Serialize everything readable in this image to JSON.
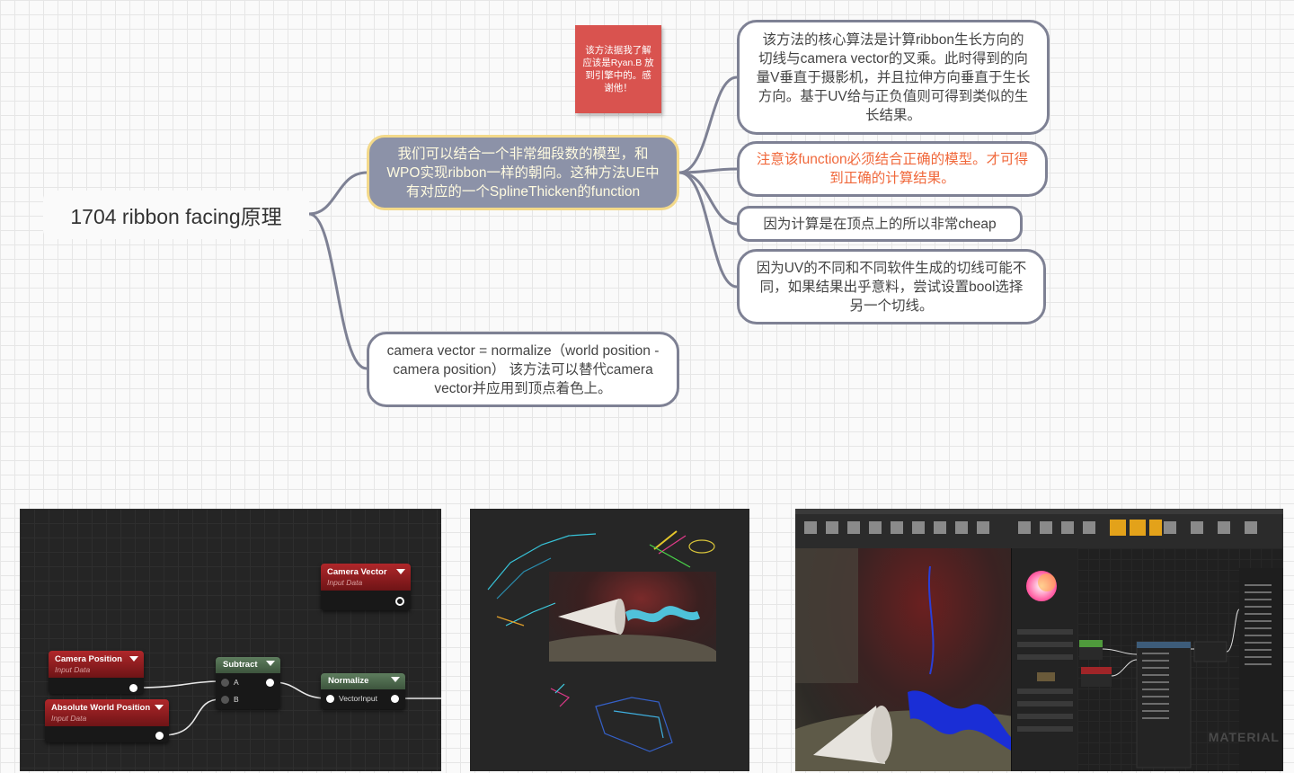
{
  "mindmap": {
    "root": "1704 ribbon facing原理",
    "main_topic": "我们可以结合一个非常细段数的模型，和WPO实现ribbon一样的朝向。这种方法UE中有对应的一个SplineThicken的function",
    "sticky_note": "该方法据我了解应该是Ryan.B 放到引擎中的。感谢他！",
    "details": [
      "该方法的核心算法是计算ribbon生长方向的切线与camera vector的叉乘。此时得到的向量V垂直于摄影机，并且拉伸方向垂直于生长方向。基于UV给与正负值则可得到类似的生长结果。",
      "注意该function必须结合正确的模型。才可得到正确的计算结果。",
      "因为计算是在顶点上的所以非常cheap",
      "因为UV的不同和不同软件生成的切线可能不同，如果结果出乎意料，尝试设置bool选择另一个切线。"
    ],
    "camera_note": "camera vector = normalize（world position - camera position） 该方法可以替代camera vector并应用到顶点着色上。"
  },
  "graph": {
    "camera_vector": {
      "title": "Camera Vector",
      "subtitle": "Input Data"
    },
    "camera_position": {
      "title": "Camera Position",
      "subtitle": "Input Data"
    },
    "abs_world_position": {
      "title": "Absolute World Position",
      "subtitle": "Input Data"
    },
    "subtract": {
      "title": "Subtract",
      "pin_a": "A",
      "pin_b": "B"
    },
    "normalize": {
      "title": "Normalize",
      "pin_in": "VectorInput"
    }
  },
  "editor": {
    "watermark": "MATERIAL"
  },
  "colors": {
    "node_border": "#7e8194",
    "main_fill": "#8c92a8",
    "main_border": "#f3d98a",
    "orange_text": "#f0683b",
    "sticky": "#d9534f"
  }
}
